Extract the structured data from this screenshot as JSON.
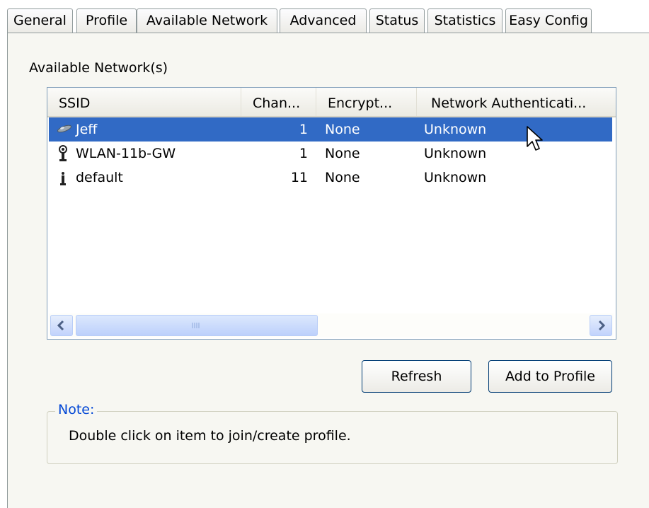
{
  "tabs": [
    {
      "label": "General",
      "active": false
    },
    {
      "label": "Profile",
      "active": false
    },
    {
      "label": "Available Network",
      "active": true
    },
    {
      "label": "Advanced",
      "active": false
    },
    {
      "label": "Status",
      "active": false
    },
    {
      "label": "Statistics",
      "active": false
    },
    {
      "label": "Easy Config",
      "active": false
    }
  ],
  "section": {
    "label": "Available Network(s)"
  },
  "list": {
    "columns": [
      "SSID",
      "Chan...",
      "Encrypt...",
      "Network Authenticati..."
    ],
    "rows": [
      {
        "ssid": "Jeff",
        "channel": "1",
        "encryption": "None",
        "auth": "Unknown",
        "icon": "adhoc-network-icon",
        "selected": true
      },
      {
        "ssid": "WLAN-11b-GW",
        "channel": "1",
        "encryption": "None",
        "auth": "Unknown",
        "icon": "access-point-icon",
        "selected": false
      },
      {
        "ssid": "default",
        "channel": "11",
        "encryption": "None",
        "auth": "Unknown",
        "icon": "access-point-icon",
        "selected": false
      }
    ]
  },
  "buttons": {
    "refresh": "Refresh",
    "add_to_profile": "Add to Profile"
  },
  "note": {
    "title": "Note:",
    "text": "Double click on item to join/create profile."
  },
  "colors": {
    "selection": "#316ac5",
    "tab_accent": "#ffc83c",
    "group_title": "#0046d5"
  }
}
